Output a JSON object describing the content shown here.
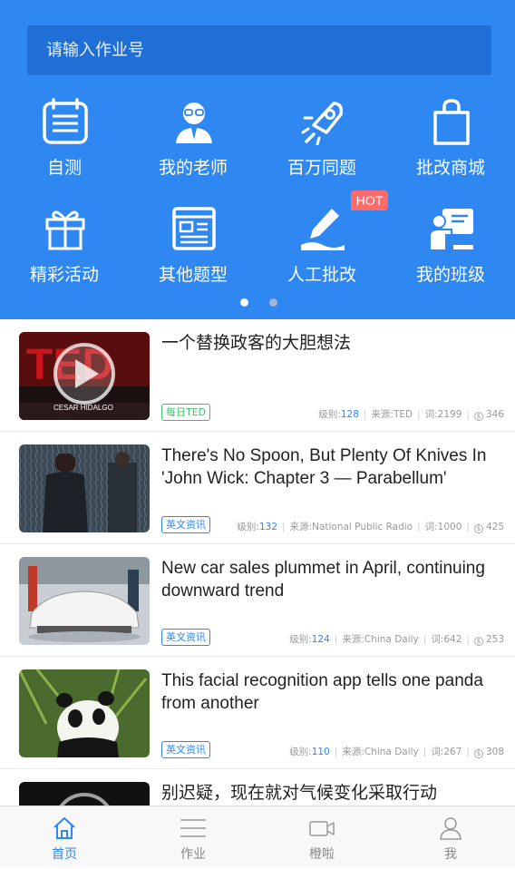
{
  "search": {
    "placeholder": "请输入作业号"
  },
  "grid": [
    {
      "label": "自测",
      "icon": "calendar-icon"
    },
    {
      "label": "我的老师",
      "icon": "teacher-icon"
    },
    {
      "label": "百万同题",
      "icon": "rocket-icon"
    },
    {
      "label": "批改商城",
      "icon": "shopping-bag-icon"
    },
    {
      "label": "精彩活动",
      "icon": "gift-icon"
    },
    {
      "label": "其他题型",
      "icon": "document-icon"
    },
    {
      "label": "人工批改",
      "icon": "pen-icon",
      "badge": "HOT"
    },
    {
      "label": "我的班级",
      "icon": "class-board-icon"
    }
  ],
  "pager": {
    "count": 2,
    "active": 0
  },
  "articles": [
    {
      "title": "一个替换政客的大胆想法",
      "tag": "每日TED",
      "tag_color": "#3cc26b",
      "level_label": "级别:",
      "level": "128",
      "source": "来源:TED",
      "words": "词:2199",
      "coins": "346",
      "thumb_caption": "CESAR HIDALGO"
    },
    {
      "title": "There's No Spoon, But Plenty Of Knives In 'John Wick: Chapter 3 — Parabellum'",
      "tag": "英文资讯",
      "tag_color": "#2f87f2",
      "level_label": "级别:",
      "level": "132",
      "source": "来源:National Public Radio",
      "words": "词:1000",
      "coins": "425"
    },
    {
      "title": "New car sales plummet in April, continuing downward trend",
      "tag": "英文资讯",
      "tag_color": "#2f87f2",
      "level_label": "级别:",
      "level": "124",
      "source": "来源:China Daily",
      "words": "词:642",
      "coins": "253"
    },
    {
      "title": "This facial recognition app tells one panda from another",
      "tag": "英文资讯",
      "tag_color": "#2f87f2",
      "level_label": "级别:",
      "level": "110",
      "source": "来源:China Daily",
      "words": "词:267",
      "coins": "308"
    },
    {
      "title": "别迟疑，现在就对气候变化采取行动",
      "tag": "",
      "tag_color": "#3cc26b",
      "level_label": "",
      "level": "",
      "source": "",
      "words": "",
      "coins": ""
    }
  ],
  "tabbar": [
    {
      "label": "首页",
      "icon": "home-icon",
      "active": true
    },
    {
      "label": "作业",
      "icon": "menu-lines-icon",
      "active": false
    },
    {
      "label": "橙啦",
      "icon": "video-camera-icon",
      "active": false
    },
    {
      "label": "我",
      "icon": "user-icon",
      "active": false
    }
  ],
  "colors": {
    "primary": "#2f87f2",
    "search_bg": "#1f6fd6",
    "hot_badge": "#ff6b6b",
    "ted_green": "#3cc26b"
  }
}
